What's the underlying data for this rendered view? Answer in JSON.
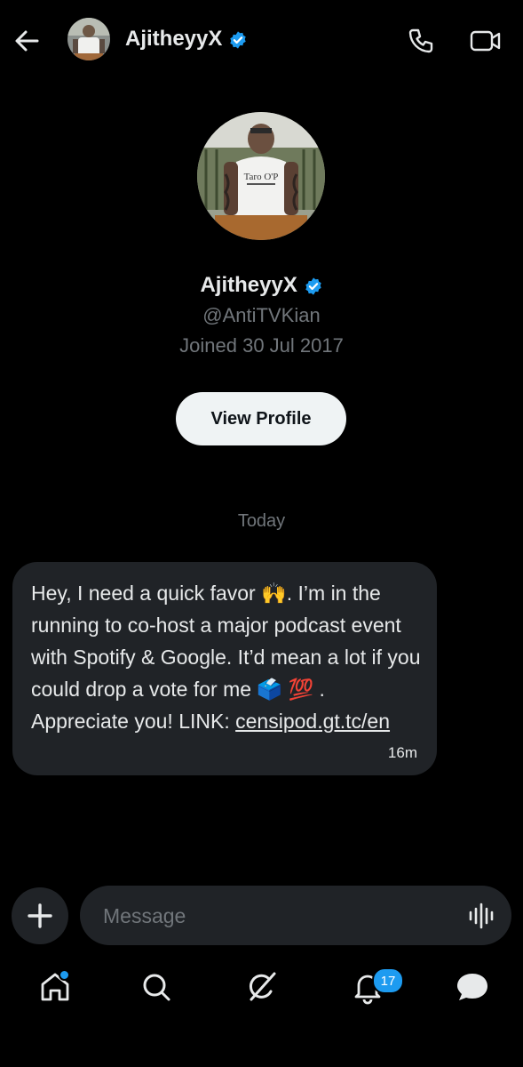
{
  "header": {
    "name": "AjitheyyX"
  },
  "profile": {
    "name": "AjitheyyX",
    "handle": "@AntiTVKian",
    "joined": "Joined 30 Jul 2017",
    "view_profile_label": "View Profile",
    "avatar_shirt_text": "Taro O'P"
  },
  "conversation": {
    "date_separator": "Today",
    "messages": [
      {
        "text_before_link": "Hey, I need a quick favor 🙌. I’m in the running to co-host a major podcast event with Spotify & Google. It’d mean a lot if you could drop a vote for me 🗳️ 💯 . Appreciate you! LINK: ",
        "link": "censipod.gt.tc/en",
        "time": "16m"
      }
    ]
  },
  "composer": {
    "placeholder": "Message"
  },
  "nav": {
    "notifications_count": "17",
    "items": [
      "home-icon",
      "search-icon",
      "grok-icon",
      "notifications-icon",
      "messages-icon"
    ]
  },
  "colors": {
    "background": "#000000",
    "bubble": "#202327",
    "accent": "#1d9bf0",
    "muted_text": "#71767b"
  }
}
